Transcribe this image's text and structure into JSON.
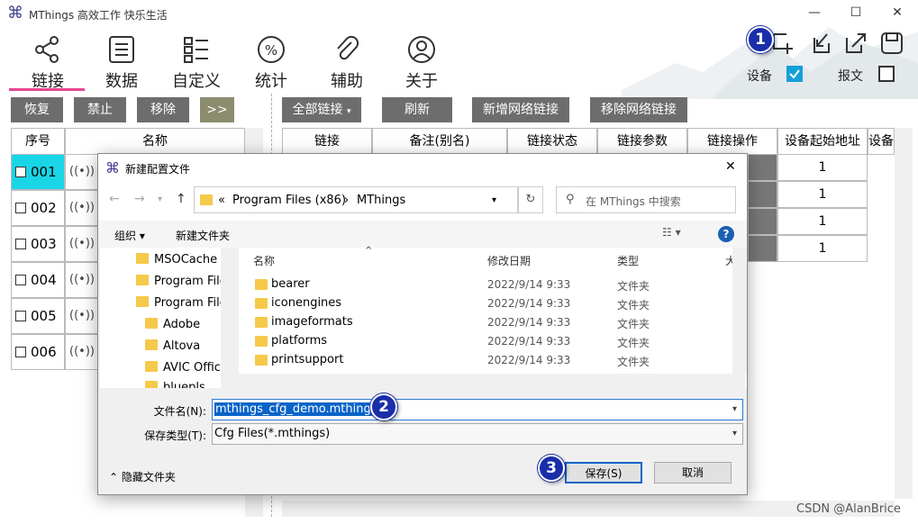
{
  "window": {
    "title": "MThings 高效工作 快乐生活",
    "min": "—",
    "max": "☐",
    "close": "✕"
  },
  "nav_tabs": [
    {
      "label": "链接"
    },
    {
      "label": "数据"
    },
    {
      "label": "自定义"
    },
    {
      "label": "统计"
    },
    {
      "label": "辅助"
    },
    {
      "label": "关于"
    }
  ],
  "top_right": {
    "device_label": "设备",
    "message_label": "报文",
    "device_checked": true,
    "message_checked": false
  },
  "left_buttons": {
    "restore": "恢复",
    "disable": "禁止",
    "remove": "移除",
    "more": ">>"
  },
  "right_buttons": {
    "all_links": "全部链接",
    "refresh": "刷新",
    "add_net": "新增网络链接",
    "remove_net": "移除网络链接"
  },
  "left_grid": {
    "headers": [
      "序号",
      "名称"
    ],
    "rows": [
      "001",
      "002",
      "003",
      "004",
      "005",
      "006"
    ],
    "icon": "((•))"
  },
  "right_grid": {
    "headers": [
      "链接",
      "备注(别名)",
      "链接状态",
      "链接参数",
      "链接操作",
      "设备起始地址",
      "设备"
    ],
    "start_addresses": [
      "1",
      "1",
      "1",
      "1"
    ]
  },
  "dialog": {
    "title": "新建配置文件",
    "close": "✕",
    "path": [
      "«",
      "Program Files (x86)",
      "›",
      "MThings"
    ],
    "search_placeholder": "在 MThings 中搜索",
    "organize": "组织 ▾",
    "new_folder": "新建文件夹",
    "help": "?",
    "tree": [
      "MSOCache",
      "Program Files",
      "Program Files",
      "Adobe",
      "Altova",
      "AVIC Office",
      "bluepls"
    ],
    "columns": {
      "name": "名称",
      "date": "修改日期",
      "type": "类型",
      "size": "大"
    },
    "files": [
      {
        "name": "bearer",
        "date": "2022/9/14 9:33",
        "type": "文件夹"
      },
      {
        "name": "iconengines",
        "date": "2022/9/14 9:33",
        "type": "文件夹"
      },
      {
        "name": "imageformats",
        "date": "2022/9/14 9:33",
        "type": "文件夹"
      },
      {
        "name": "platforms",
        "date": "2022/9/14 9:33",
        "type": "文件夹"
      },
      {
        "name": "printsupport",
        "date": "2022/9/14 9:33",
        "type": "文件夹"
      }
    ],
    "filename_label": "文件名(N):",
    "filename_value": "mthings_cfg_demo.mthings",
    "filetype_label": "保存类型(T):",
    "filetype_value": "Cfg Files(*.mthings)",
    "hide_folders": "隐藏文件夹",
    "save": "保存(S)",
    "cancel": "取消"
  },
  "badges": [
    "1",
    "2",
    "3"
  ],
  "watermark": "CSDN @AlanBrice",
  "colors": {
    "accent": "#14a0d8",
    "selected_row": "#19d6e6",
    "tab_underline": "#e5488f",
    "button_gray": "#6d6d6d",
    "badge": "#1a2ea8"
  }
}
